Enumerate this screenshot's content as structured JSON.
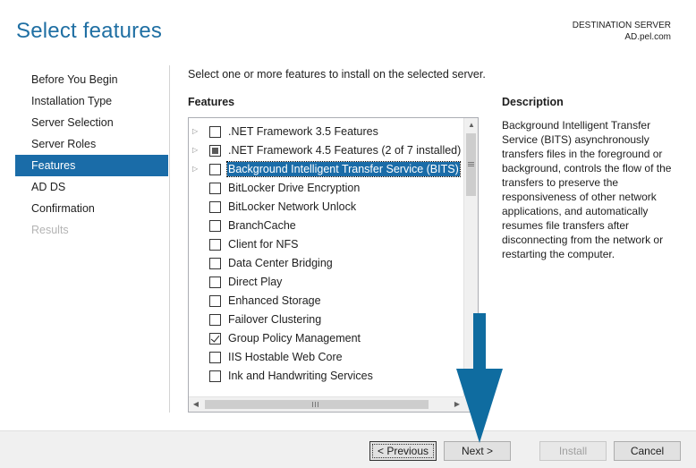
{
  "header": {
    "title": "Select features",
    "dest_label": "DESTINATION SERVER",
    "dest_server": "AD.pel.com"
  },
  "nav": {
    "items": [
      {
        "label": "Before You Begin",
        "state": "normal"
      },
      {
        "label": "Installation Type",
        "state": "normal"
      },
      {
        "label": "Server Selection",
        "state": "normal"
      },
      {
        "label": "Server Roles",
        "state": "normal"
      },
      {
        "label": "Features",
        "state": "active"
      },
      {
        "label": "AD DS",
        "state": "normal"
      },
      {
        "label": "Confirmation",
        "state": "normal"
      },
      {
        "label": "Results",
        "state": "disabled"
      }
    ]
  },
  "main": {
    "instruction": "Select one or more features to install on the selected server.",
    "features_heading": "Features",
    "features": [
      {
        "label": ".NET Framework 3.5 Features",
        "state": "unchecked",
        "expandable": true,
        "selected": false
      },
      {
        "label": ".NET Framework 4.5 Features (2 of 7 installed)",
        "state": "partial",
        "expandable": true,
        "selected": false
      },
      {
        "label": "Background Intelligent Transfer Service (BITS)",
        "state": "unchecked",
        "expandable": true,
        "selected": true
      },
      {
        "label": "BitLocker Drive Encryption",
        "state": "unchecked",
        "expandable": false,
        "selected": false
      },
      {
        "label": "BitLocker Network Unlock",
        "state": "unchecked",
        "expandable": false,
        "selected": false
      },
      {
        "label": "BranchCache",
        "state": "unchecked",
        "expandable": false,
        "selected": false
      },
      {
        "label": "Client for NFS",
        "state": "unchecked",
        "expandable": false,
        "selected": false
      },
      {
        "label": "Data Center Bridging",
        "state": "unchecked",
        "expandable": false,
        "selected": false
      },
      {
        "label": "Direct Play",
        "state": "unchecked",
        "expandable": false,
        "selected": false
      },
      {
        "label": "Enhanced Storage",
        "state": "unchecked",
        "expandable": false,
        "selected": false
      },
      {
        "label": "Failover Clustering",
        "state": "unchecked",
        "expandable": false,
        "selected": false
      },
      {
        "label": "Group Policy Management",
        "state": "checked",
        "expandable": false,
        "selected": false
      },
      {
        "label": "IIS Hostable Web Core",
        "state": "unchecked",
        "expandable": false,
        "selected": false
      },
      {
        "label": "Ink and Handwriting Services",
        "state": "unchecked",
        "expandable": false,
        "selected": false
      }
    ],
    "description_heading": "Description",
    "description_text": "Background Intelligent Transfer Service (BITS) asynchronously transfers files in the foreground or background, controls the flow of the transfers to preserve the responsiveness of other network applications, and automatically resumes file transfers after disconnecting from the network or restarting the computer."
  },
  "footer": {
    "previous_label": "< Previous",
    "next_label": "Next >",
    "install_label": "Install",
    "cancel_label": "Cancel"
  },
  "colors": {
    "accent": "#1a6ca8",
    "title": "#1f6fa3",
    "annotation_arrow": "#0f6ca0"
  },
  "icons": {
    "expander": "triangle-right-icon",
    "annotation": "down-arrow-icon"
  }
}
